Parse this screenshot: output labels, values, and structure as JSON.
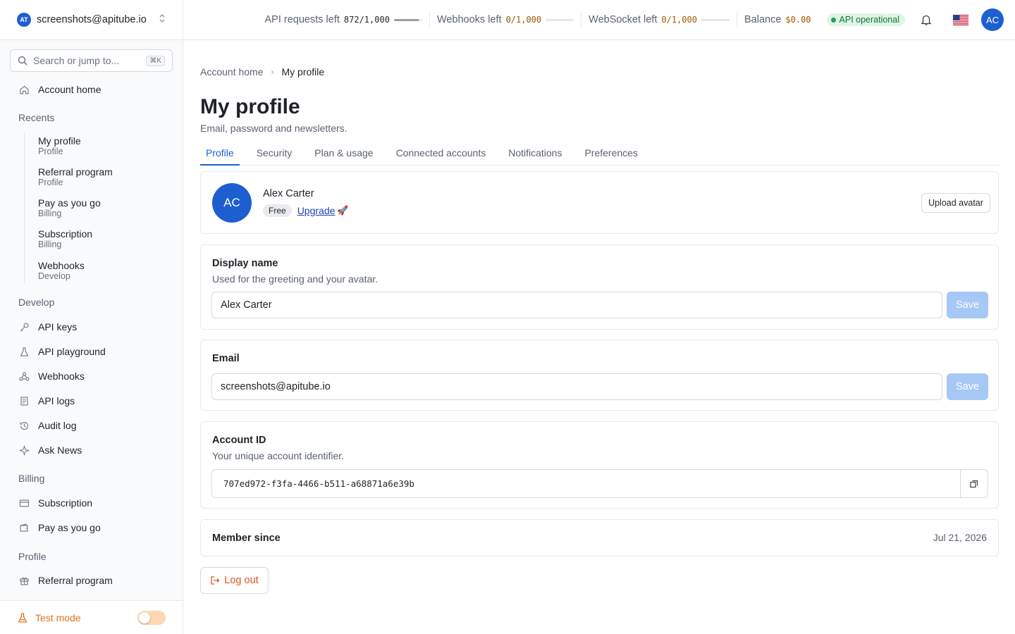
{
  "account": {
    "logo": "AT",
    "email": "screenshots@apitube.io"
  },
  "search": {
    "placeholder": "Search or jump to...",
    "shortcut": "⌘K"
  },
  "sidebar": {
    "home": "Account home",
    "recents_title": "Recents",
    "recents": [
      {
        "title": "My profile",
        "sub": "Profile"
      },
      {
        "title": "Referral program",
        "sub": "Profile"
      },
      {
        "title": "Pay as you go",
        "sub": "Billing"
      },
      {
        "title": "Subscription",
        "sub": "Billing"
      },
      {
        "title": "Webhooks",
        "sub": "Develop"
      }
    ],
    "develop_title": "Develop",
    "develop": [
      "API keys",
      "API playground",
      "Webhooks",
      "API logs",
      "Audit log",
      "Ask News"
    ],
    "billing_title": "Billing",
    "billing": [
      "Subscription",
      "Pay as you go"
    ],
    "profile_title": "Profile",
    "profile": [
      "Referral program"
    ],
    "test_mode": "Test mode",
    "test_mode_on": false
  },
  "topbar": {
    "requests_label": "API requests left",
    "requests_value": "872/1,000",
    "requests_fraction": 0.872,
    "webhooks_label": "Webhooks left",
    "webhooks_value": "0/1,000",
    "webhooks_fraction": 0,
    "websocket_label": "WebSocket left",
    "websocket_value": "0/1,000",
    "websocket_fraction": 0,
    "balance_label": "Balance",
    "balance_value": "$0.00",
    "status": "API operational",
    "avatar": "AC"
  },
  "colors": {
    "accent": "#1d5fd1",
    "status_green": "#1aa351",
    "warning_orange": "#e0751f",
    "danger": "#e0541f"
  },
  "breadcrumb": {
    "parent": "Account home",
    "current": "My profile"
  },
  "page": {
    "title": "My profile",
    "subtitle": "Email, password and newsletters."
  },
  "tabs": [
    "Profile",
    "Security",
    "Plan & usage",
    "Connected accounts",
    "Notifications",
    "Preferences"
  ],
  "profile": {
    "avatar": "AC",
    "name": "Alex Carter",
    "plan": "Free",
    "upgrade": "Upgrade",
    "upload": "Upload avatar"
  },
  "display_name": {
    "label": "Display name",
    "help": "Used for the greeting and your avatar.",
    "value": "Alex Carter",
    "save": "Save"
  },
  "email": {
    "label": "Email",
    "value": "screenshots@apitube.io",
    "save": "Save"
  },
  "account_id": {
    "label": "Account ID",
    "help": "Your unique account identifier.",
    "value": "707ed972-f3fa-4466-b511-a68871a6e39b"
  },
  "member_since": {
    "label": "Member since",
    "value": "Jul 21, 2026"
  },
  "logout": "Log out"
}
